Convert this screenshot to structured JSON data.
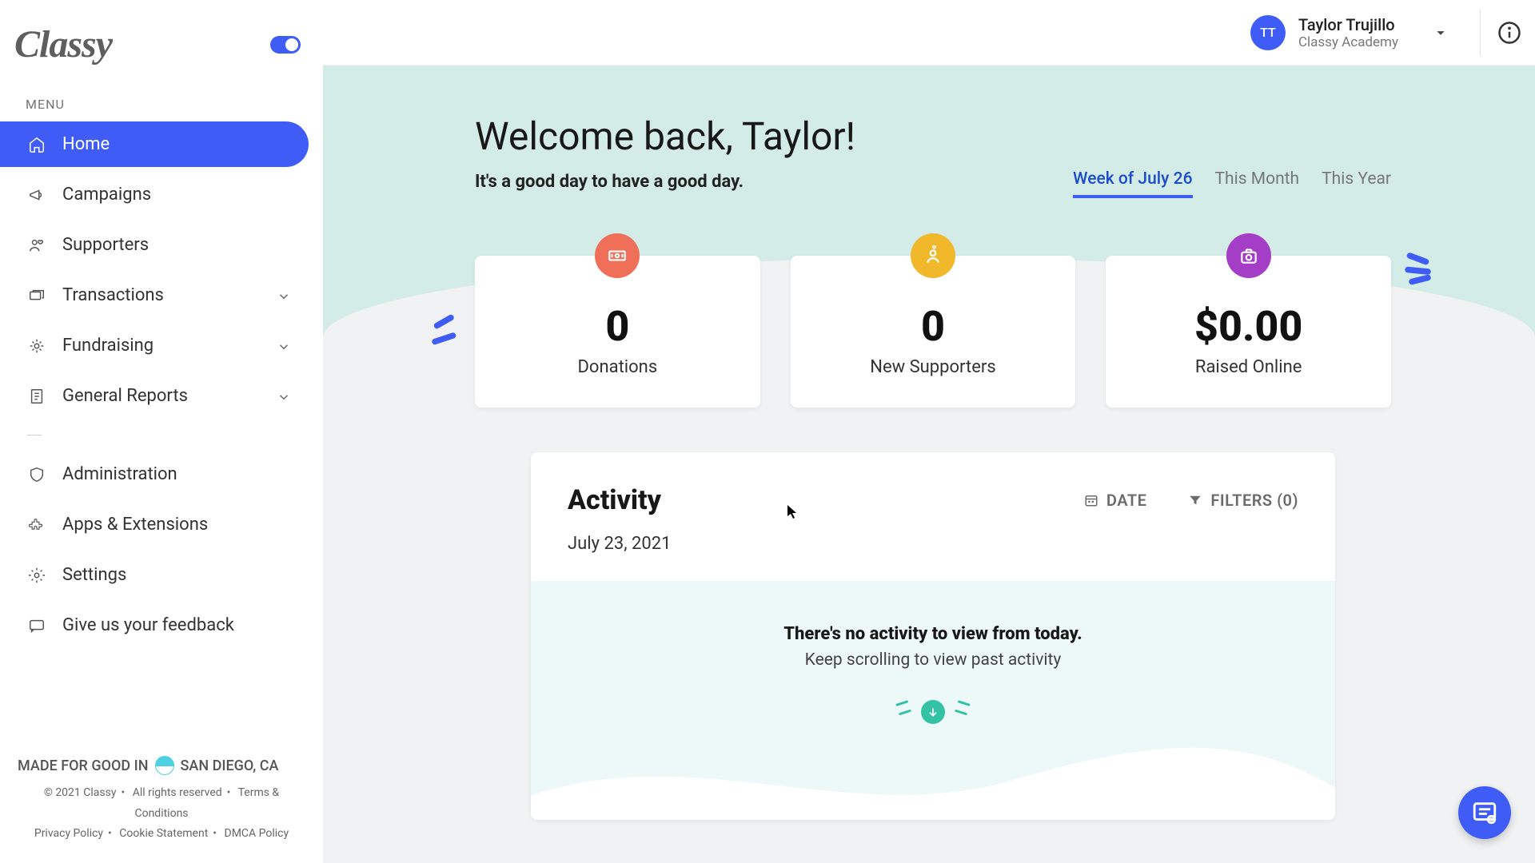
{
  "brand": "Classy",
  "sidebar": {
    "menu_label": "MENU",
    "items": [
      {
        "label": "Home"
      },
      {
        "label": "Campaigns"
      },
      {
        "label": "Supporters"
      },
      {
        "label": "Transactions"
      },
      {
        "label": "Fundraising"
      },
      {
        "label": "General Reports"
      }
    ],
    "secondary": [
      {
        "label": "Administration"
      },
      {
        "label": "Apps & Extensions"
      },
      {
        "label": "Settings"
      },
      {
        "label": "Give us your feedback"
      }
    ],
    "footer": {
      "made_prefix": "MADE FOR GOOD IN",
      "city": "SAN DIEGO, CA",
      "copyright": "© 2021 Classy",
      "rights": "All rights reserved",
      "terms": "Terms & Conditions",
      "privacy": "Privacy Policy",
      "cookie": "Cookie Statement",
      "dmca": "DMCA Policy"
    }
  },
  "header": {
    "user_initials": "TT",
    "user_name": "Taylor Trujillo",
    "org_name": "Classy Academy"
  },
  "main": {
    "welcome": "Welcome back, Taylor!",
    "tagline": "It's a good day to have a good day.",
    "ranges": [
      "Week of July 26",
      "This Month",
      "This Year"
    ],
    "cards": {
      "donations": {
        "value": "0",
        "label": "Donations"
      },
      "supporters": {
        "value": "0",
        "label": "New Supporters"
      },
      "raised": {
        "value": "$0.00",
        "label": "Raised Online"
      }
    },
    "activity": {
      "title": "Activity",
      "date_btn": "DATE",
      "filters_btn": "FILTERS (0)",
      "date": "July 23, 2021",
      "empty_title": "There's no activity to view from today.",
      "empty_sub": "Keep scrolling to view past activity"
    }
  }
}
